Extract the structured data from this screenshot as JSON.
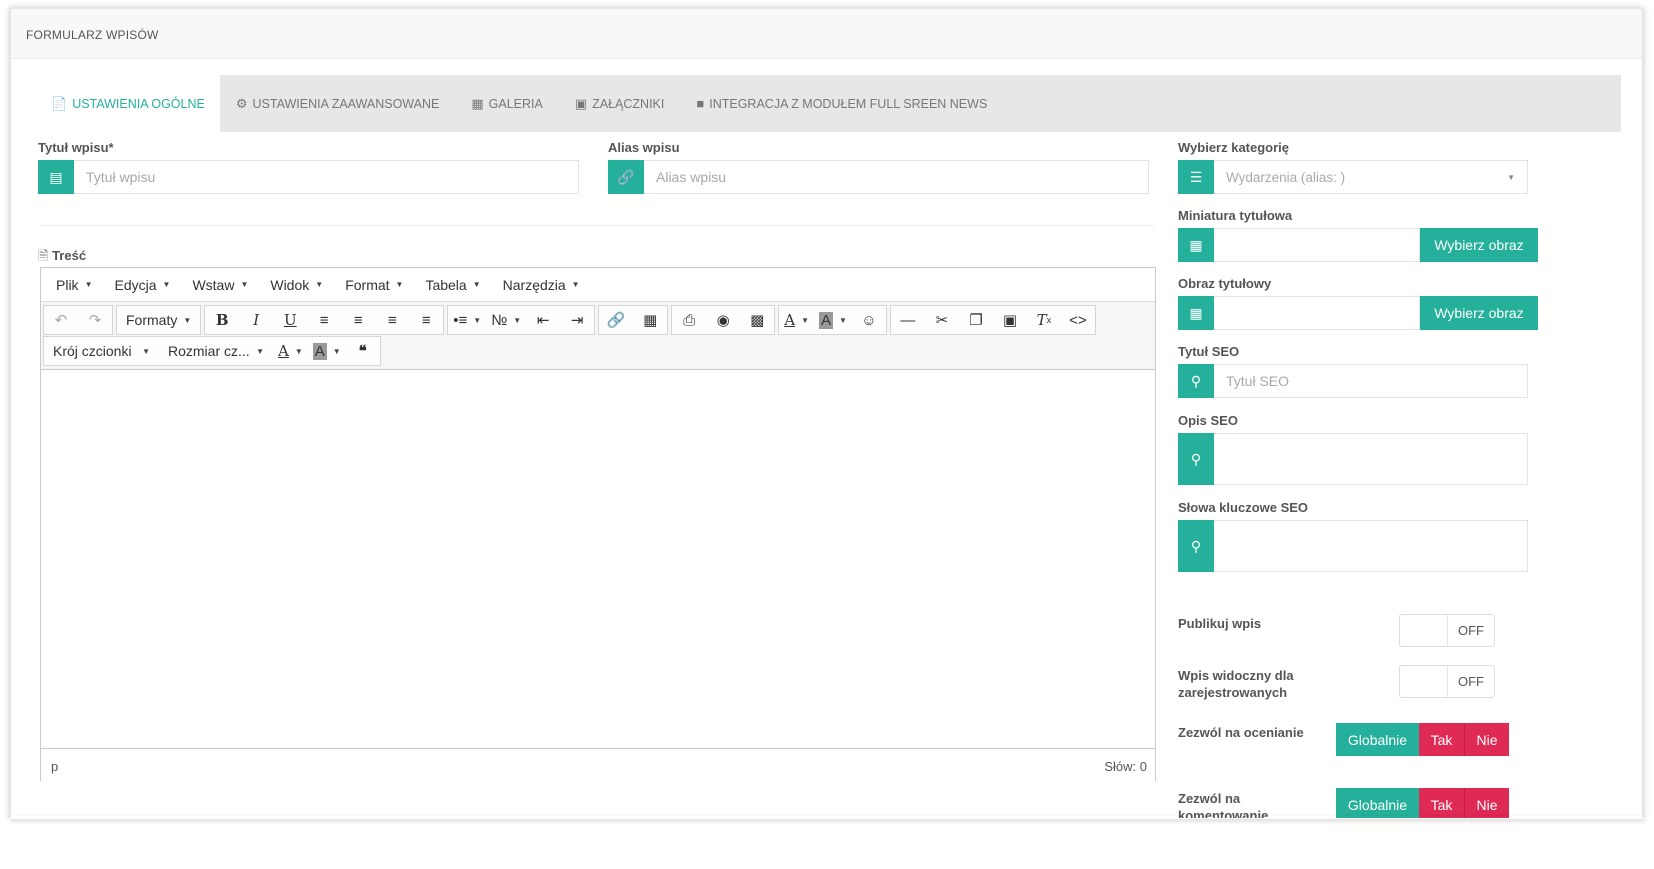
{
  "panel": {
    "title": "FORMULARZ WPISÓW"
  },
  "tabs": [
    {
      "label": "USTAWIENIA OGÓLNE",
      "icon": "file-icon"
    },
    {
      "label": "USTAWIENIA ZAAWANSOWANE",
      "icon": "gears-icon"
    },
    {
      "label": "GALERIA",
      "icon": "image-icon"
    },
    {
      "label": "ZAŁĄCZNIKI",
      "icon": "inbox-icon"
    },
    {
      "label": "INTEGRACJA Z MODUŁEM FULL SREEN NEWS",
      "icon": "square-icon"
    }
  ],
  "form": {
    "title": {
      "label": "Tytuł wpisu*",
      "placeholder": "Tytuł wpisu"
    },
    "alias": {
      "label": "Alias wpisu",
      "placeholder": "Alias wpisu"
    },
    "category": {
      "label": "Wybierz kategorię",
      "value": "Wydarzenia (alias: )"
    },
    "thumbnail": {
      "label": "Miniatura tytułowa",
      "button": "Wybierz obraz"
    },
    "title_image": {
      "label": "Obraz tytułowy",
      "button": "Wybierz obraz"
    },
    "seo_title": {
      "label": "Tytuł SEO",
      "placeholder": "Tytuł SEO"
    },
    "seo_desc": {
      "label": "Opis SEO"
    },
    "seo_keywords": {
      "label": "Słowa kluczowe SEO"
    },
    "publish": {
      "label": "Publikuj wpis",
      "state": "OFF"
    },
    "registered": {
      "label_line1": "Wpis widoczny dla",
      "label_line2": "zarejestrowanych",
      "state": "OFF"
    },
    "rating": {
      "label": "Zezwól na ocenianie",
      "options": [
        "Globalnie",
        "Tak",
        "Nie"
      ]
    },
    "comments": {
      "label_line1": "Zezwól na",
      "label_line2": "komentowanie",
      "options": [
        "Globalnie",
        "Tak",
        "Nie"
      ]
    }
  },
  "editor": {
    "label": "Treść",
    "menus": [
      "Plik",
      "Edycja",
      "Wstaw",
      "Widok",
      "Format",
      "Tabela",
      "Narzędzia"
    ],
    "formats": "Formaty",
    "font_family": "Krój czcionki",
    "font_size": "Rozmiar cz...",
    "status_path": "p",
    "word_count": "Słów: 0"
  },
  "colors": {
    "accent": "#25b09b",
    "danger": "#de2a55"
  }
}
